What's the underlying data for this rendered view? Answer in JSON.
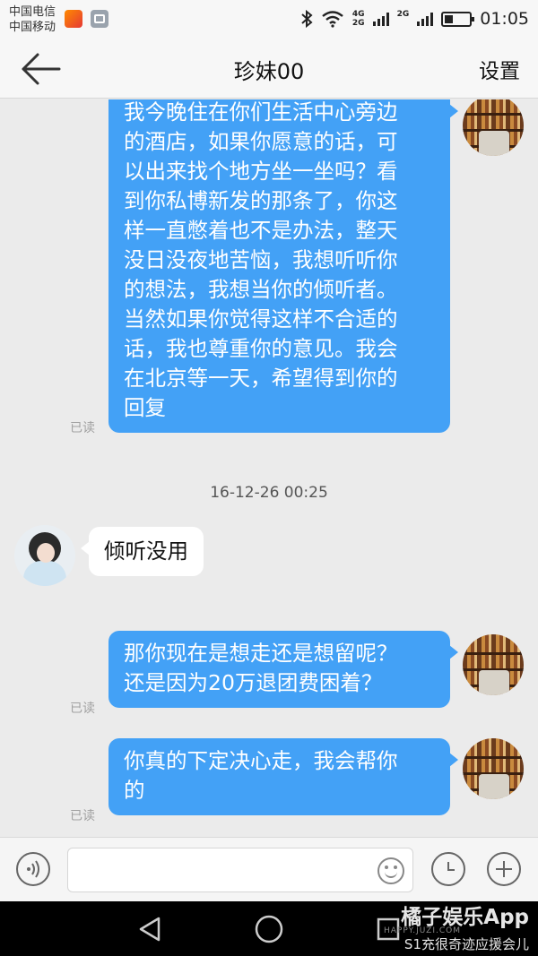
{
  "status_bar": {
    "carrier_1": "中国电信",
    "carrier_2": "中国移动",
    "network_1": "4G",
    "network_2": "2G",
    "network_3": "2G",
    "time": "01:05",
    "icons": [
      "bluetooth-icon",
      "wifi-icon",
      "signal-icon",
      "battery-icon"
    ]
  },
  "header": {
    "title": "珍妹00",
    "settings_label": "设置"
  },
  "messages": [
    {
      "side": "out",
      "lines": [
        "我今晚住在你们生活中心旁边",
        "的酒店，如果你愿意的话，可",
        "以出来找个地方坐一坐吗？看",
        "到你私博新发的那条了，你这",
        "样一直憋着也不是办法，整天",
        "没日没夜地苦恼，我想听听你",
        "的想法，我想当你的倾听者。",
        "当然如果你觉得这样不合适的",
        "话，我也尊重你的意见。我会",
        "在北京等一天，希望得到你的",
        "回复"
      ],
      "status": "已读"
    },
    {
      "timestamp": "16-12-26 00:25"
    },
    {
      "side": "in",
      "text": "倾听没用"
    },
    {
      "side": "out",
      "lines": [
        "那你现在是想走还是想留呢？",
        "还是因为20万退团费困着？"
      ],
      "status": "已读"
    },
    {
      "side": "out",
      "lines": [
        "你真的下定决心走，我会帮你",
        "的"
      ],
      "status": "已读"
    }
  ],
  "input_bar": {
    "text_value": "",
    "buttons": [
      "voice-icon",
      "emoji-icon",
      "clock-icon",
      "plus-icon"
    ]
  },
  "watermark": {
    "brand": "橘子娱乐App",
    "url": "HAPPY.JUZI.COM",
    "credit": "S1充很奇迹应援会儿"
  },
  "colors": {
    "outgoing_bubble": "#43a1f6",
    "background": "#ebebeb"
  }
}
